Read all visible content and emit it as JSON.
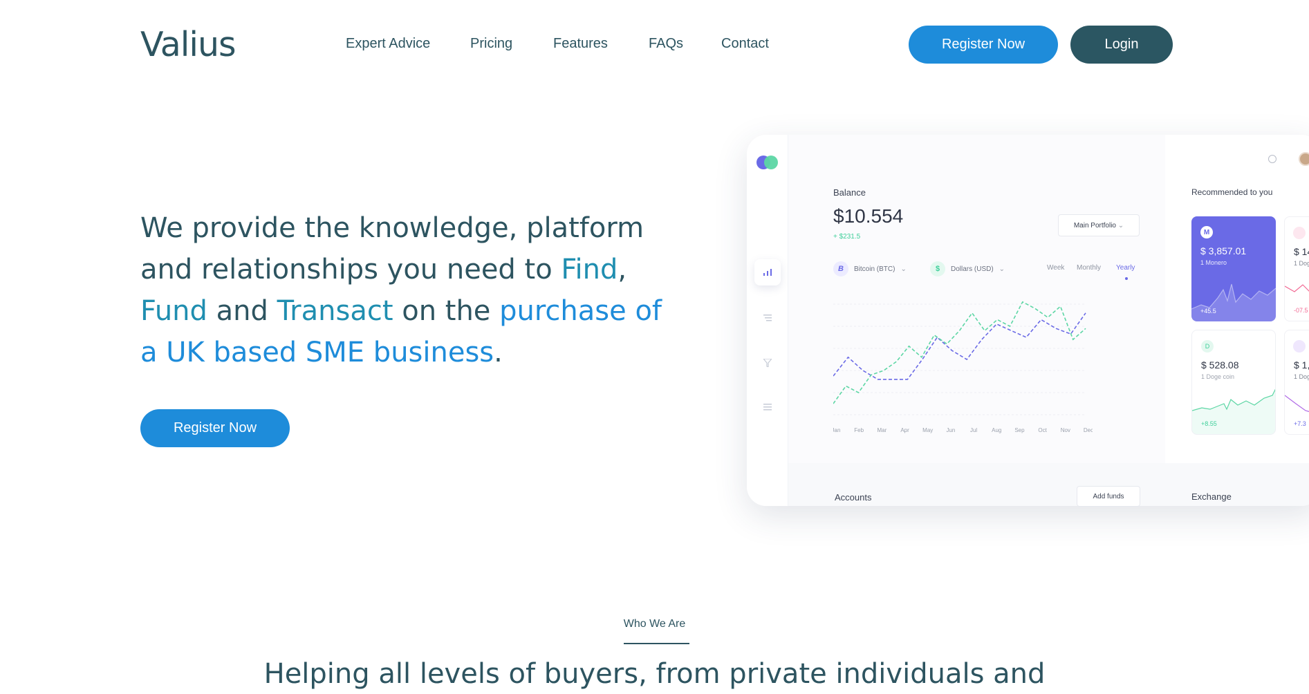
{
  "header": {
    "logo": "Valius",
    "nav": [
      "Expert Advice",
      "Pricing",
      "Features",
      "FAQs",
      "Contact"
    ],
    "register_label": "Register Now",
    "login_label": "Login"
  },
  "hero": {
    "t1": "We provide the knowledge, platform and relationships you need to ",
    "find": "Find",
    "t2": ", ",
    "fund": "Fund",
    "t3": " and ",
    "transact": "Transact",
    "t4": " on the ",
    "purchase": "purchase of a UK based SME business",
    "t5": ".",
    "register_label": "Register Now"
  },
  "dashboard": {
    "balance_label": "Balance",
    "balance_value": "$10.554",
    "balance_delta": "+ $231.5",
    "portfolio_select": "Main Portfolio",
    "coin_a_symbol": "B",
    "coin_a": "Bitcoin (BTC)",
    "coin_b_symbol": "$",
    "coin_b": "Dollars (USD)",
    "periods": [
      "Week",
      "Monthly",
      "Yearly"
    ],
    "recommended_title": "Recommended to you",
    "cards": {
      "monero_symbol": "M",
      "monero_price": "$ 3,857.01",
      "monero_sub": "1 Monero",
      "monero_delta": "+45.5",
      "pink_price": "$ 14",
      "pink_sub": "1 Dog",
      "pink_delta": "-07.5",
      "doge_symbol": "D",
      "doge_price": "$ 528.08",
      "doge_sub": "1 Doge coin",
      "doge_delta": "+8.55",
      "purple_price": "$ 1,",
      "purple_sub": "1 Dog",
      "purple_delta": "+7.3"
    },
    "accounts_label": "Accounts",
    "add_funds_label": "Add funds",
    "exchange_label": "Exchange"
  },
  "who": {
    "label": "Who We Are",
    "heading": "Helping all levels of buyers, from private individuals and"
  },
  "chart_data": {
    "type": "line",
    "categories": [
      "Jan",
      "Feb",
      "Mar",
      "Apr",
      "May",
      "Jun",
      "Jul",
      "Aug",
      "Sep",
      "Oct",
      "Nov",
      "Dec"
    ],
    "series": [
      {
        "values": [
          55,
          72,
          60,
          52,
          52,
          52,
          70,
          90,
          78,
          70,
          88,
          102,
          96,
          90,
          106,
          98,
          93,
          112
        ]
      },
      {
        "values": [
          30,
          46,
          40,
          56,
          60,
          68,
          82,
          72,
          92,
          84,
          96,
          112,
          96,
          106,
          100,
          122,
          116,
          108,
          118,
          88,
          98
        ]
      }
    ],
    "colors": {
      "purple": "#6a6ae6",
      "green": "#5cd6a4"
    },
    "grid": true
  }
}
